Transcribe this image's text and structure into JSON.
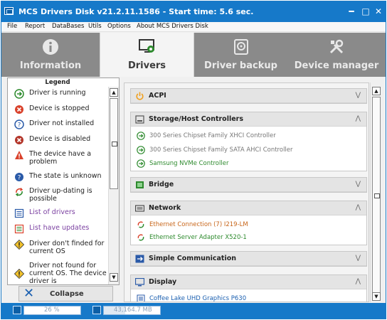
{
  "window": {
    "title": "MCS Drivers Disk v21.2.11.1586 - Start time: 5.6 sec.",
    "controls": {
      "minimize": "━",
      "maximize": "□",
      "close": "✕"
    }
  },
  "menu": [
    "File",
    "Report",
    "DataBases",
    "Utils",
    "Options",
    "About MCS Drivers Disk"
  ],
  "tabs": [
    {
      "label": "Information",
      "icon": "info-icon",
      "active": false
    },
    {
      "label": "Drivers",
      "icon": "monitor-gear-icon",
      "active": true
    },
    {
      "label": "Driver backup",
      "icon": "backup-disk-icon",
      "active": false
    },
    {
      "label": "Device manager",
      "icon": "wrench-screwdriver-icon",
      "active": false
    }
  ],
  "legend": {
    "title": "Legend",
    "items": [
      {
        "label": "Driver is running",
        "icon": "running-arrow-icon",
        "color": "#222222"
      },
      {
        "label": "Device is stopped",
        "icon": "stopped-x-icon",
        "color": "#222222"
      },
      {
        "label": "Driver not installed",
        "icon": "question-circle-icon",
        "color": "#222222"
      },
      {
        "label": "Device is disabled",
        "icon": "disabled-x-icon",
        "color": "#222222"
      },
      {
        "label": "The device have a problem",
        "icon": "warning-triangle-icon",
        "color": "#222222"
      },
      {
        "label": "The state is unknown",
        "icon": "unknown-question-icon",
        "color": "#222222"
      },
      {
        "label": "Driver up-dating is possible",
        "icon": "update-arrows-icon",
        "color": "#222222"
      },
      {
        "label": "List of drivers",
        "icon": "list-icon",
        "color": "#7a3fa0"
      },
      {
        "label": "List have updates",
        "icon": "list-updates-icon",
        "color": "#7a3fa0"
      },
      {
        "label": "Driver don't finded for current OS",
        "icon": "diamond-warning-icon",
        "color": "#222222"
      },
      {
        "label": "Driver not found for current OS. The device driver is",
        "icon": "diamond-warning-icon",
        "color": "#222222"
      }
    ]
  },
  "collapse_button": {
    "label": "Collapse"
  },
  "groups": [
    {
      "title": "ACPI",
      "icon": "power-icon",
      "expanded": false,
      "drivers": []
    },
    {
      "title": "Storage/Host Controllers",
      "icon": "storage-icon",
      "expanded": true,
      "drivers": [
        {
          "name": "300 Series Chipset Family XHCI Controller",
          "status": "running",
          "color": "#777777"
        },
        {
          "name": "300 Series Chipset Family SATA AHCI Controller",
          "status": "running",
          "color": "#777777"
        },
        {
          "name": "Samsung NVMe Controller",
          "status": "running",
          "color": "#2d8a2d"
        }
      ]
    },
    {
      "title": "Bridge",
      "icon": "bridge-icon",
      "expanded": false,
      "drivers": []
    },
    {
      "title": "Network",
      "icon": "network-icon",
      "expanded": true,
      "drivers": [
        {
          "name": "Ethernet Connection (7) I219-LM",
          "status": "update",
          "color": "#c8661a"
        },
        {
          "name": "Ethernet Server Adapter X520-1",
          "status": "update",
          "color": "#2d8a2d"
        }
      ]
    },
    {
      "title": "Simple Communication",
      "icon": "communication-icon",
      "expanded": false,
      "drivers": []
    },
    {
      "title": "Display",
      "icon": "display-icon",
      "expanded": true,
      "drivers": [
        {
          "name": "Coffee Lake UHD Graphics P630",
          "status": "list",
          "color": "#1a5fb0"
        }
      ]
    }
  ],
  "status": {
    "cpu": "26 %",
    "memory": "43,164.7 MB",
    "cpu_fraction": 0.26,
    "memory_fraction": 0.38
  }
}
